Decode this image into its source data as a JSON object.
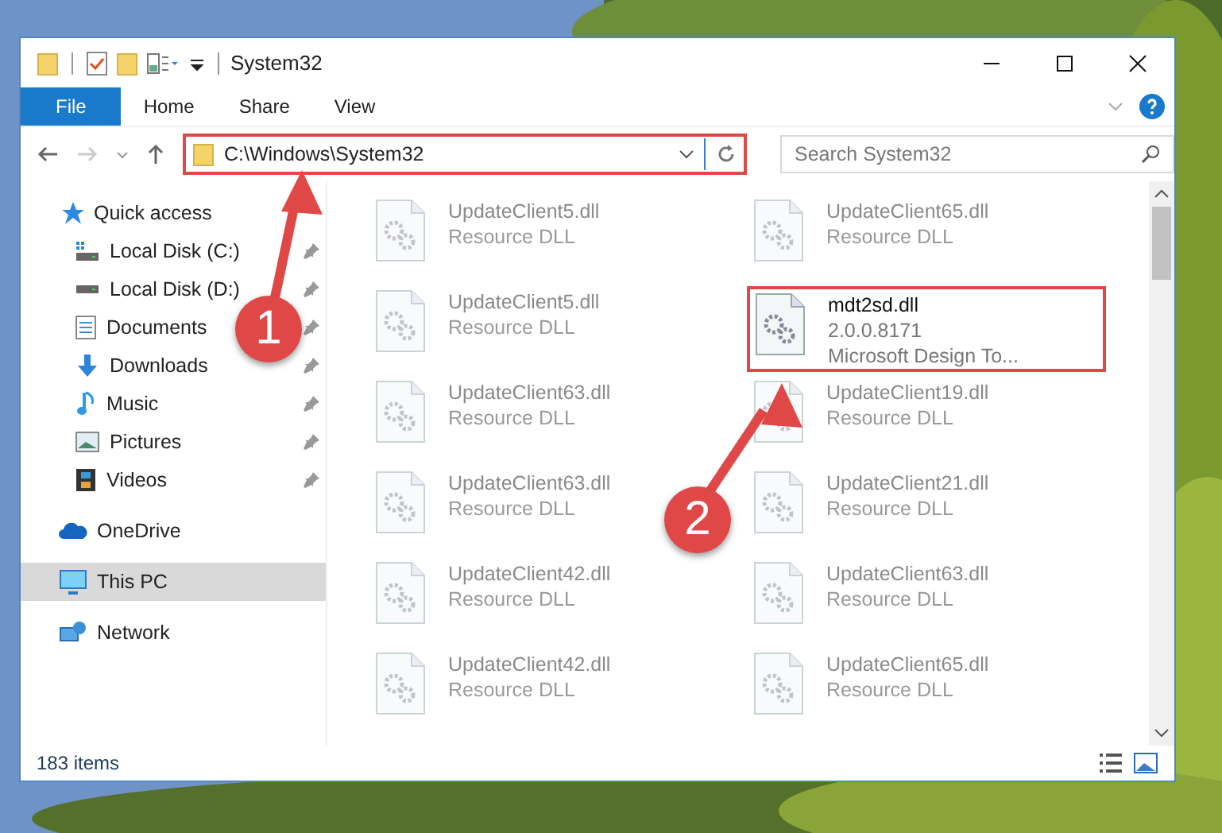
{
  "window": {
    "title": "System32"
  },
  "ribbon_tabs": [
    {
      "label": "File",
      "selected": true
    },
    {
      "label": "Home",
      "selected": false
    },
    {
      "label": "Share",
      "selected": false
    },
    {
      "label": "View",
      "selected": false
    }
  ],
  "address": {
    "path": "C:\\Windows\\System32",
    "highlighted": true
  },
  "search": {
    "placeholder": "Search System32"
  },
  "sidebar": {
    "items": [
      {
        "label": "Quick access",
        "kind": "star",
        "selected": false,
        "children": [
          {
            "label": "Local Disk (C:)",
            "kind": "system-disk",
            "pinned": true
          },
          {
            "label": "Local Disk (D:)",
            "kind": "disk",
            "pinned": true
          },
          {
            "label": "Documents",
            "kind": "documents",
            "pinned": true
          },
          {
            "label": "Downloads",
            "kind": "downloads",
            "pinned": true
          },
          {
            "label": "Music",
            "kind": "music",
            "pinned": true
          },
          {
            "label": "Pictures",
            "kind": "pictures",
            "pinned": true
          },
          {
            "label": "Videos",
            "kind": "videos",
            "pinned": true
          }
        ]
      },
      {
        "label": "OneDrive",
        "kind": "cloud",
        "selected": false
      },
      {
        "label": "This PC",
        "kind": "pc",
        "selected": true
      },
      {
        "label": "Network",
        "kind": "network",
        "selected": false
      }
    ]
  },
  "files": [
    {
      "name": "UpdateClient5.dll",
      "lines": [
        "Resource DLL"
      ],
      "blurred": true,
      "highlighted": false
    },
    {
      "name": "UpdateClient65.dll",
      "lines": [
        "Resource DLL"
      ],
      "blurred": true,
      "highlighted": false
    },
    {
      "name": "UpdateClient5.dll",
      "lines": [
        "Resource DLL"
      ],
      "blurred": true,
      "highlighted": false
    },
    {
      "name": "mdt2sd.dll",
      "lines": [
        "2.0.0.8171",
        "Microsoft Design To..."
      ],
      "blurred": false,
      "highlighted": true
    },
    {
      "name": "UpdateClient63.dll",
      "lines": [
        "Resource DLL"
      ],
      "blurred": true,
      "highlighted": false
    },
    {
      "name": "UpdateClient19.dll",
      "lines": [
        "Resource DLL"
      ],
      "blurred": true,
      "highlighted": false
    },
    {
      "name": "UpdateClient63.dll",
      "lines": [
        "Resource DLL"
      ],
      "blurred": true,
      "highlighted": false
    },
    {
      "name": "UpdateClient21.dll",
      "lines": [
        "Resource DLL"
      ],
      "blurred": true,
      "highlighted": false
    },
    {
      "name": "UpdateClient42.dll",
      "lines": [
        "Resource DLL"
      ],
      "blurred": true,
      "highlighted": false
    },
    {
      "name": "UpdateClient63.dll",
      "lines": [
        "Resource DLL"
      ],
      "blurred": true,
      "highlighted": false
    },
    {
      "name": "UpdateClient42.dll",
      "lines": [
        "Resource DLL"
      ],
      "blurred": true,
      "highlighted": false
    },
    {
      "name": "UpdateClient65.dll",
      "lines": [
        "Resource DLL"
      ],
      "blurred": true,
      "highlighted": false
    }
  ],
  "status_bar": {
    "item_count": "183 items"
  },
  "annotations": [
    {
      "number": "1"
    },
    {
      "number": "2"
    }
  ]
}
